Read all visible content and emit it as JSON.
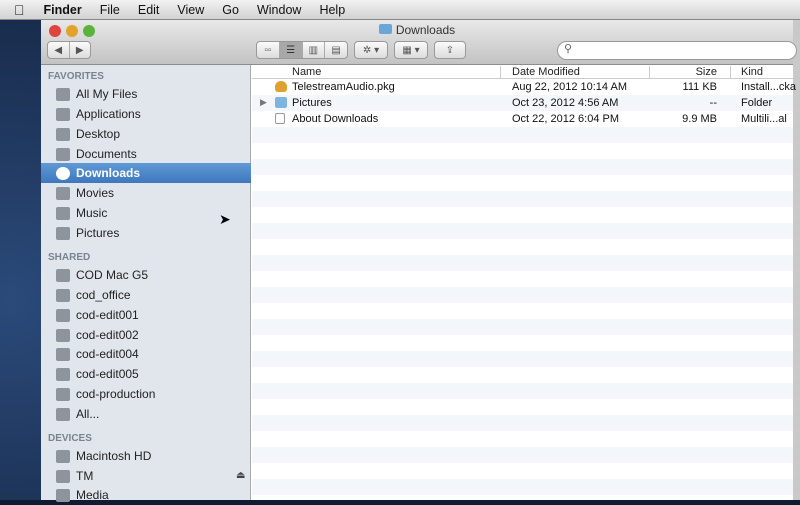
{
  "menubar": {
    "app": "Finder",
    "items": [
      "File",
      "Edit",
      "View",
      "Go",
      "Window",
      "Help"
    ]
  },
  "window": {
    "title": "Downloads"
  },
  "toolbar": {
    "back": "◀",
    "forward": "▶",
    "views": [
      "icon",
      "list",
      "column",
      "coverflow"
    ],
    "action": "✲ ▾",
    "arrange": "▦ ▾",
    "share": "⇪",
    "search_placeholder": ""
  },
  "sidebar": {
    "favorites_header": "FAVORITES",
    "favorites": [
      "All My Files",
      "Applications",
      "Desktop",
      "Documents",
      "Downloads",
      "Movies",
      "Music",
      "Pictures"
    ],
    "shared_header": "SHARED",
    "shared": [
      "COD Mac G5",
      "cod_office",
      "cod-edit001",
      "cod-edit002",
      "cod-edit004",
      "cod-edit005",
      "cod-production",
      "All..."
    ],
    "devices_header": "DEVICES",
    "devices": [
      "Macintosh HD",
      "TM",
      "Media"
    ]
  },
  "columns": {
    "name": "Name",
    "date": "Date Modified",
    "size": "Size",
    "kind": "Kind"
  },
  "files": [
    {
      "name": "TelestreamAudio.pkg",
      "date": "Aug 22, 2012 10:14 AM",
      "size": "111 KB",
      "kind": "Install...cka",
      "icon": "package-icon"
    },
    {
      "name": "Pictures",
      "date": "Oct 23, 2012 4:56 AM",
      "size": "--",
      "kind": "Folder",
      "icon": "folder-icon"
    },
    {
      "name": "About Downloads",
      "date": "Oct 22, 2012 6:04 PM",
      "size": "9.9 MB",
      "kind": "Multili...al",
      "icon": "document-icon"
    }
  ]
}
